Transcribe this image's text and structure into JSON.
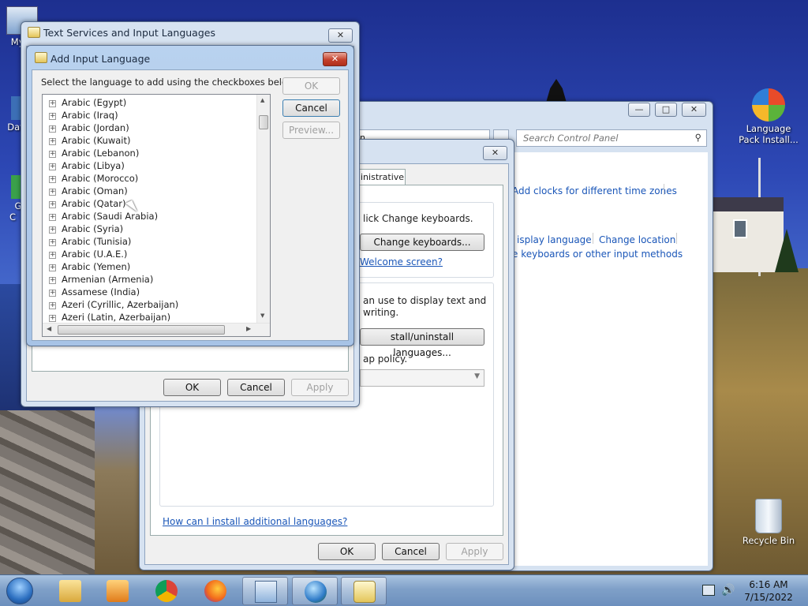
{
  "desktop": {
    "icons": [
      {
        "label": "My C"
      },
      {
        "label": "Data"
      },
      {
        "label": "G\nC"
      },
      {
        "label": "Language\nPack Install..."
      },
      {
        "label": "Recycle Bin"
      }
    ]
  },
  "control_panel": {
    "search_placeholder": "Search Control Panel",
    "address_fragment": "n",
    "links": {
      "clocks": "Add clocks for different time zones",
      "display_language": "isplay language",
      "change_location": "Change location",
      "keyboards": "e keyboards or other input methods"
    }
  },
  "region_dialog": {
    "tab_admin": "inistrative",
    "text_change_kb": "lick Change keyboards.",
    "btn_change_kb": "Change keyboards...",
    "link_welcome": "Welcome screen?",
    "text_display_1": "an use to display text and",
    "text_display_2": "writing.",
    "btn_install": "stall/uninstall languages...",
    "text_policy": "ap policy.",
    "link_install": "How can I install additional languages?",
    "ok": "OK",
    "cancel": "Cancel",
    "apply": "Apply"
  },
  "text_services": {
    "title": "Text Services and Input Languages",
    "ok": "OK",
    "cancel": "Cancel",
    "apply": "Apply"
  },
  "add_input_language": {
    "title": "Add Input Language",
    "instruction": "Select the language to add using the checkboxes below.",
    "ok": "OK",
    "cancel": "Cancel",
    "preview": "Preview...",
    "languages": [
      "Arabic (Egypt)",
      "Arabic (Iraq)",
      "Arabic (Jordan)",
      "Arabic (Kuwait)",
      "Arabic (Lebanon)",
      "Arabic (Libya)",
      "Arabic (Morocco)",
      "Arabic (Oman)",
      "Arabic (Qatar)",
      "Arabic (Saudi Arabia)",
      "Arabic (Syria)",
      "Arabic (Tunisia)",
      "Arabic (U.A.E.)",
      "Arabic (Yemen)",
      "Armenian (Armenia)",
      "Assamese (India)",
      "Azeri (Cyrillic, Azerbaijan)",
      "Azeri (Latin, Azerbaijan)"
    ]
  },
  "taskbar": {
    "time": "6:16 AM",
    "date": "7/15/2022"
  }
}
